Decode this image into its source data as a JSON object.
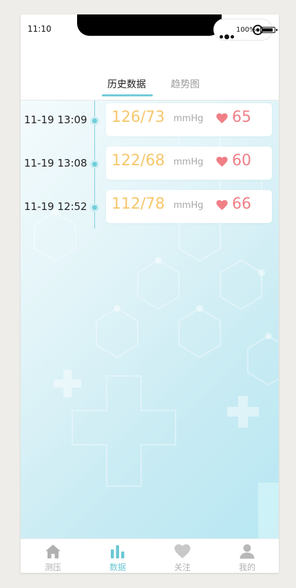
{
  "status_bar": {
    "time": "11:10",
    "battery_text": "100%"
  },
  "tabs": [
    {
      "label": "历史数据",
      "active": true
    },
    {
      "label": "趋势图",
      "active": false
    }
  ],
  "records": [
    {
      "time": "11-19 13:09",
      "bp": "126/73",
      "unit": "mmHg",
      "heart_rate": "65"
    },
    {
      "time": "11-19 13:08",
      "bp": "122/68",
      "unit": "mmHg",
      "heart_rate": "60"
    },
    {
      "time": "11-19 12:52",
      "bp": "112/78",
      "unit": "mmHg",
      "heart_rate": "66"
    }
  ],
  "tabbar": [
    {
      "label": "测压",
      "icon": "home-icon",
      "active": false
    },
    {
      "label": "数据",
      "icon": "bar-chart-icon",
      "active": true
    },
    {
      "label": "关注",
      "icon": "heart-icon",
      "active": false
    },
    {
      "label": "我的",
      "icon": "user-icon",
      "active": false
    }
  ],
  "colors": {
    "accent": "#6bc7d3",
    "bp_value": "#f6c76b",
    "heart_rate": "#f07f86",
    "inactive": "#b0b0b0"
  }
}
